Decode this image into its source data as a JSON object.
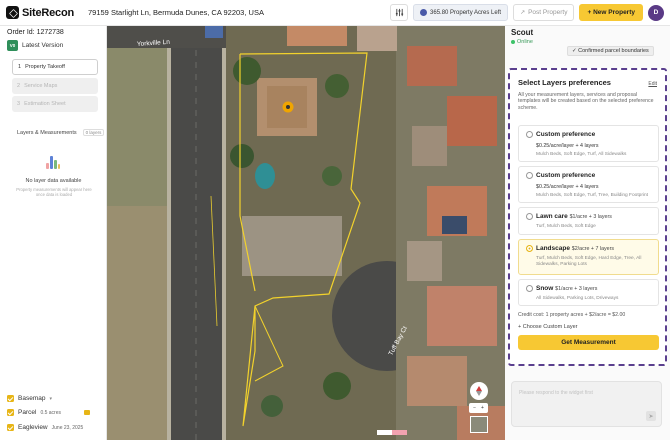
{
  "header": {
    "logo": "SiteRecon",
    "address": "79159 Starlight Ln, Bermuda Dunes, CA 92203, USA",
    "acres_badge": "365.80 Property Acres Left",
    "post_property": "Post Property",
    "new_property": "+ New Property",
    "avatar_initial": "D"
  },
  "left": {
    "order_id": "Order Id: 1272738",
    "version_badge": "V0",
    "version_label": "Latest Version",
    "steps": [
      {
        "num": "1",
        "label": "Property Takeoff"
      },
      {
        "num": "2",
        "label": "Service Maps"
      },
      {
        "num": "3",
        "label": "Estimation Sheet"
      }
    ],
    "layers_title": "Layers & Measurements",
    "layers_count": "0 layers",
    "empty_title": "No layer data available",
    "empty_sub": "Property measurements will appear here once data is loaded",
    "basemap": "Basemap",
    "parcel": "Parcel",
    "parcel_value": "0.5 acres",
    "eagleview": "Eagleview",
    "eagleview_date": "June 23, 2025"
  },
  "map": {
    "street_labels": [
      "Yorkville Ln",
      "Tuff Bay Ct"
    ],
    "compass": "N"
  },
  "right": {
    "title": "Scout",
    "status": "Online",
    "confirmed": "✓ Confirmed parcel boundaries",
    "card_title": "Select Layers preferences",
    "edit": "Edit",
    "desc": "All your measurement layers, services and proposal templates will be created based on the selected preference scheme.",
    "prefs": [
      {
        "name": "Custom preference",
        "price": "",
        "sub": "$0.25/acre/layer + 4 layers",
        "tags": "Mulch Beds, Soft Edge, Turf, All Sidewalks"
      },
      {
        "name": "Custom preference",
        "price": "",
        "sub": "$0.25/acre/layer + 4 layers",
        "tags": "Mulch Beds, Soft Edge, Turf, Tree, Building Footprint"
      },
      {
        "name": "Lawn care",
        "price": "$1/acre + 3 layers",
        "sub": "",
        "tags": "Turf, Mulch Beds, Soft Edge"
      },
      {
        "name": "Landscape",
        "price": "$2/acre + 7 layers",
        "sub": "",
        "tags": "Turf, Mulch Beds, Soft Edge, Hard Edge, Tree, All Sidewalks, Parking Lots"
      },
      {
        "name": "Snow",
        "price": "$1/acre + 3 layers",
        "sub": "",
        "tags": "All Sidewalks, Parking Lots, Driveways"
      }
    ],
    "credit_cost": "Credit cost: 1 property acres + $2/acre = $2.00",
    "choose_custom": "+ Choose Custom Layer",
    "get_measurement": "Get Measurement",
    "chat_placeholder": "Please respond to the widget first"
  }
}
